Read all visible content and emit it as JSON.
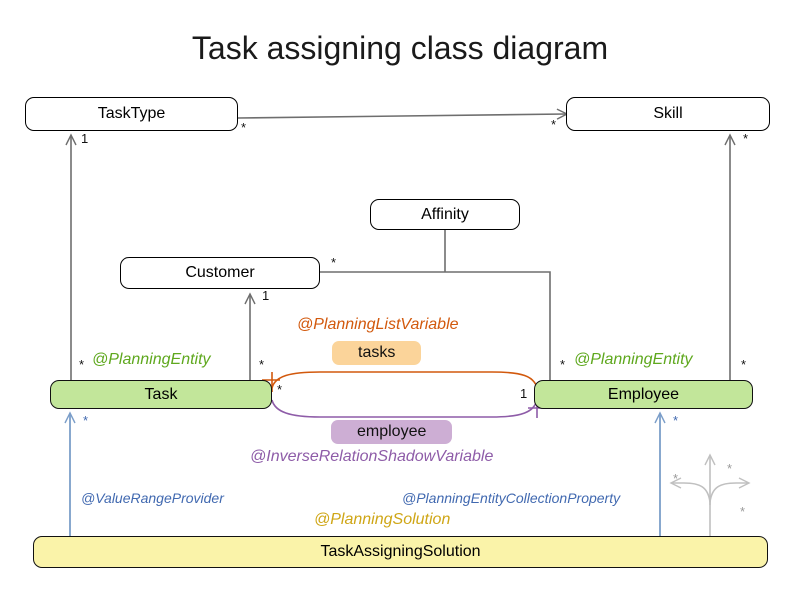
{
  "title": "Task assigning class diagram",
  "classes": {
    "task_type": {
      "name": "TaskType"
    },
    "skill": {
      "name": "Skill"
    },
    "affinity": {
      "name": "Affinity"
    },
    "customer": {
      "name": "Customer"
    },
    "task": {
      "name": "Task"
    },
    "employee": {
      "name": "Employee"
    },
    "solution": {
      "name": "TaskAssigningSolution"
    }
  },
  "annotations": {
    "planning_entity_task": "@PlanningEntity",
    "planning_entity_employee": "@PlanningEntity",
    "planning_list_variable": "@PlanningListVariable",
    "inverse_relation_shadow_variable": "@InverseRelationShadowVariable",
    "value_range_provider": "@ValueRangeProvider",
    "planning_entity_collection_property": "@PlanningEntityCollectionProperty",
    "planning_solution": "@PlanningSolution"
  },
  "fields": {
    "tasks": "tasks",
    "employee": "employee"
  },
  "multiplicities": {
    "tasktype_to_skill_source": "*",
    "tasktype_to_skill_target": "*",
    "task_to_tasktype_one": "1",
    "task_to_tasktype_star": "*",
    "task_to_customer_one": "1",
    "task_to_customer_star": "*",
    "customer_to_affinity_star": "*",
    "employee_to_customer_star": "*",
    "skill_to_employee_star": "*",
    "employee_to_skill_star": "*",
    "task_tasks_star": "*",
    "task_employee_star": "*",
    "employee_tasks_one": "1",
    "solution_to_task_star": "*",
    "solution_to_employee_star": "*",
    "solution_fan_up_star": "*",
    "solution_fan_left_star": "*",
    "solution_fan_right_star": "*"
  },
  "colors": {
    "entity_fill": "#c2e69a",
    "solution_fill": "#faf3a9",
    "tasks_field_fill": "#fbd49a",
    "employee_field_fill": "#cdaed4",
    "planning_entity_text": "#5fa81e",
    "planning_list_variable_text": "#d2590d",
    "shadow_variable_text": "#8e5ca8",
    "planning_solution_text": "#cfa616",
    "blue_annotation_text": "#4169b0",
    "line_gray": "#6e6e6e",
    "line_blue": "#7b9ec9",
    "line_light_gray": "#c0c0c0"
  }
}
